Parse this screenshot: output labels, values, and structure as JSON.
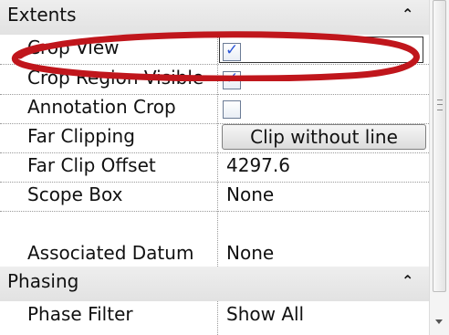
{
  "sections": [
    {
      "title": "Extents",
      "icon": "collapse-chevron-up-icon"
    },
    {
      "title": "Phasing",
      "icon": "collapse-chevron-up-icon"
    }
  ],
  "rows": [
    {
      "label": "Crop View",
      "type": "checkbox",
      "checked": true
    },
    {
      "label": "Crop Region Visible",
      "type": "checkbox",
      "checked": true
    },
    {
      "label": "Annotation Crop",
      "type": "checkbox",
      "checked": false
    },
    {
      "label": "Far Clipping",
      "type": "button",
      "value": "Clip without line"
    },
    {
      "label": "Far Clip Offset",
      "type": "text",
      "value": "4297.6"
    },
    {
      "label": "Scope Box",
      "type": "text",
      "value": "None"
    },
    {
      "label": "Associated Datum",
      "type": "text",
      "value": "None"
    },
    {
      "label": "Phase Filter",
      "type": "text",
      "value": "Show All"
    }
  ],
  "highlight": {
    "color": "#c0161c",
    "target": "Crop View"
  },
  "accent_color": "#2a55d8"
}
